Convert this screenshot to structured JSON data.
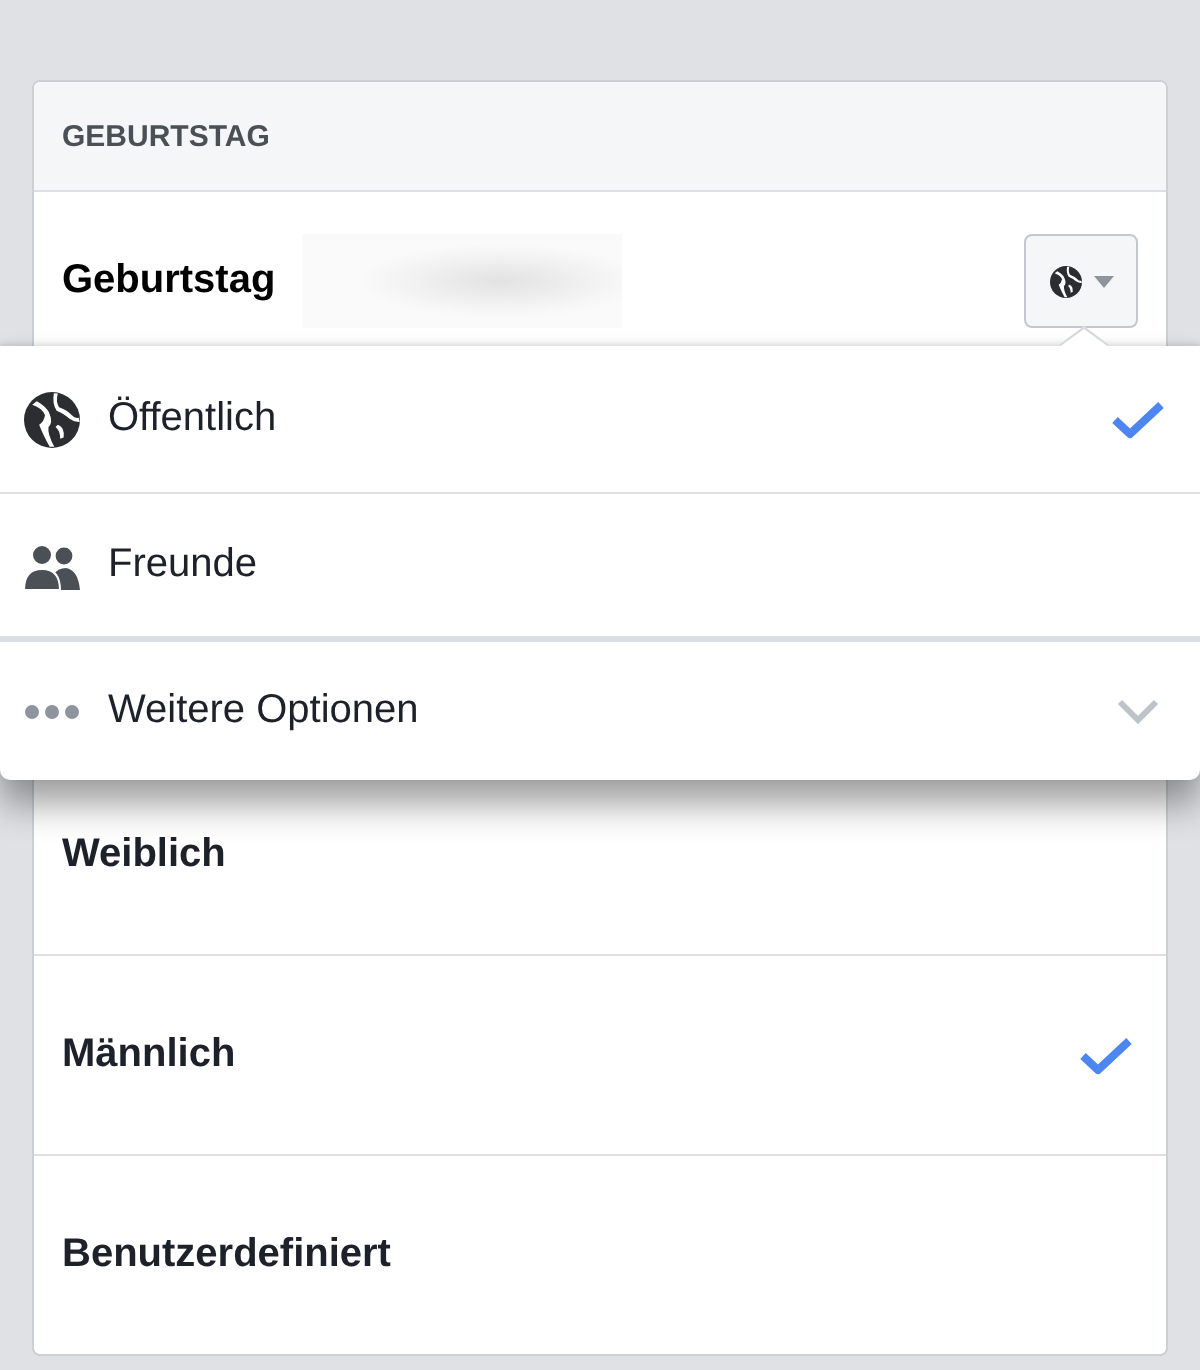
{
  "section": {
    "title": "GEBURTSTAG"
  },
  "birthday": {
    "label": "Geburtstag"
  },
  "audience_menu": {
    "items": [
      {
        "kind": "public",
        "label": "Öffentlich",
        "selected": true
      },
      {
        "kind": "friends",
        "label": "Freunde",
        "selected": false
      },
      {
        "kind": "more",
        "label": "Weitere Optionen",
        "selected": false,
        "expanded": false
      }
    ]
  },
  "gender_options": [
    {
      "label": "Weiblich",
      "selected": false
    },
    {
      "label": "Männlich",
      "selected": true
    },
    {
      "label": "Benutzerdefiniert",
      "selected": false
    }
  ]
}
